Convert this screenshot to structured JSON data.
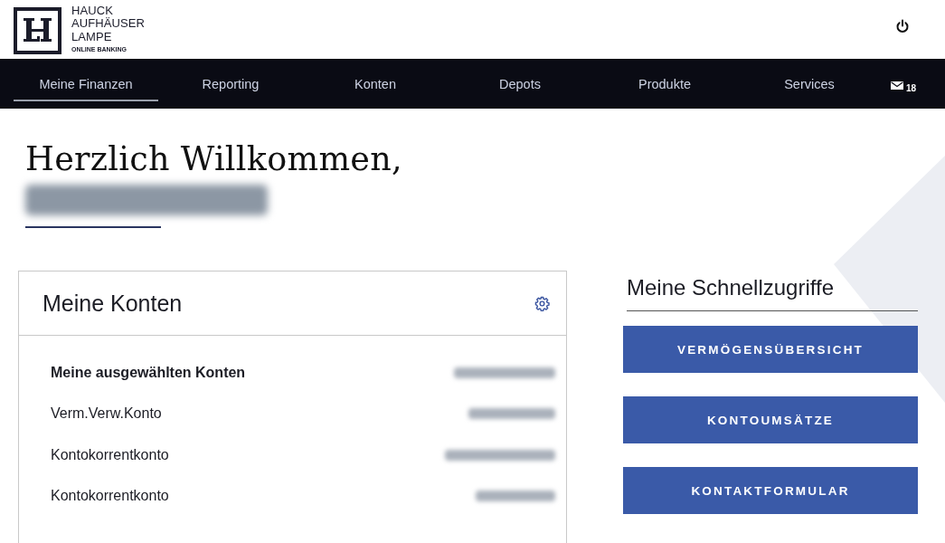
{
  "header": {
    "logo": {
      "lines": [
        "HAUCK",
        "AUFHÄUSER",
        "LAMPE"
      ],
      "tagline": "ONLINE BANKING"
    }
  },
  "nav": {
    "items": [
      {
        "label": "Meine Finanzen",
        "selected": true
      },
      {
        "label": "Reporting",
        "selected": false
      },
      {
        "label": "Konten",
        "selected": false
      },
      {
        "label": "Depots",
        "selected": false
      },
      {
        "label": "Produkte",
        "selected": false
      },
      {
        "label": "Services",
        "selected": false
      }
    ],
    "messages": {
      "count": "18"
    }
  },
  "greeting": {
    "title": "Herzlich Willkommen,",
    "name_hidden": true
  },
  "accounts_card": {
    "title": "Meine Konten",
    "rows": [
      {
        "label": "Meine ausgewählten Konten",
        "kind": "total",
        "amount_hidden": true
      },
      {
        "label": "Verm.Verw.Konto",
        "kind": "account",
        "amount_hidden": true
      },
      {
        "label": "Kontokorrentkonto",
        "kind": "account",
        "amount_hidden": true
      },
      {
        "label": "Kontokorrentkonto",
        "kind": "account",
        "amount_hidden": true
      }
    ]
  },
  "quick_access": {
    "title": "Meine Schnellzugriffe",
    "buttons": [
      "VERMÖGENSÜBERSICHT",
      "KONTOUMSÄTZE",
      "KONTAKTFORMULAR"
    ]
  }
}
